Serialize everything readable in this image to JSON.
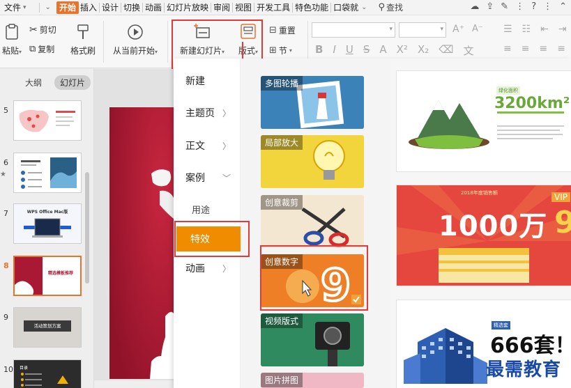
{
  "menubar": {
    "file": "文件",
    "tabs": [
      "开始",
      "插入",
      "设计",
      "切换",
      "动画",
      "幻灯片放映",
      "审阅",
      "视图",
      "开发工具",
      "特色功能",
      "口袋就"
    ],
    "active_tab": "开始",
    "search": "查找"
  },
  "ribbon": {
    "paste": "粘贴",
    "cut": "剪切",
    "copy": "复制",
    "format_painter": "格式刷",
    "from_current": "从当前开始",
    "new_slide": "新建幻灯片",
    "layout": "版式",
    "reset": "重置",
    "section": "节"
  },
  "outline": {
    "tab_outline": "大纲",
    "tab_slides": "幻灯片",
    "slide_numbers": [
      "5",
      "6",
      "7",
      "8",
      "9",
      "10"
    ],
    "current": "8",
    "thumb_texts": {
      "s7": "WPS Office Mac版",
      "s8": "精选模板推荐",
      "s9": "活动策划方案",
      "s10": "目录"
    }
  },
  "dropdown": {
    "categories": {
      "new": "新建",
      "theme": "主题页",
      "body": "正文",
      "case": "案例",
      "usage": "用途",
      "effects": "特效",
      "animation": "动画"
    },
    "cards": [
      "多图轮播",
      "局部放大",
      "创意裁剪",
      "创意数字",
      "视频版式",
      "图片拼图"
    ],
    "previews": {
      "p1_title": "绿化面积",
      "p1_value": "3200km²",
      "p2_header": "2018年度销售额",
      "p2_badge": "VIP",
      "p2_value": "1000万",
      "p3_tag": "精选套",
      "p3_value": "666套！"
    }
  },
  "watermark": "最需教育",
  "colors": {
    "accent": "#e8732c",
    "selected_category": "#ef8c00",
    "highlight_box": "#e23a3a",
    "slide_red": "#b51d3a"
  }
}
